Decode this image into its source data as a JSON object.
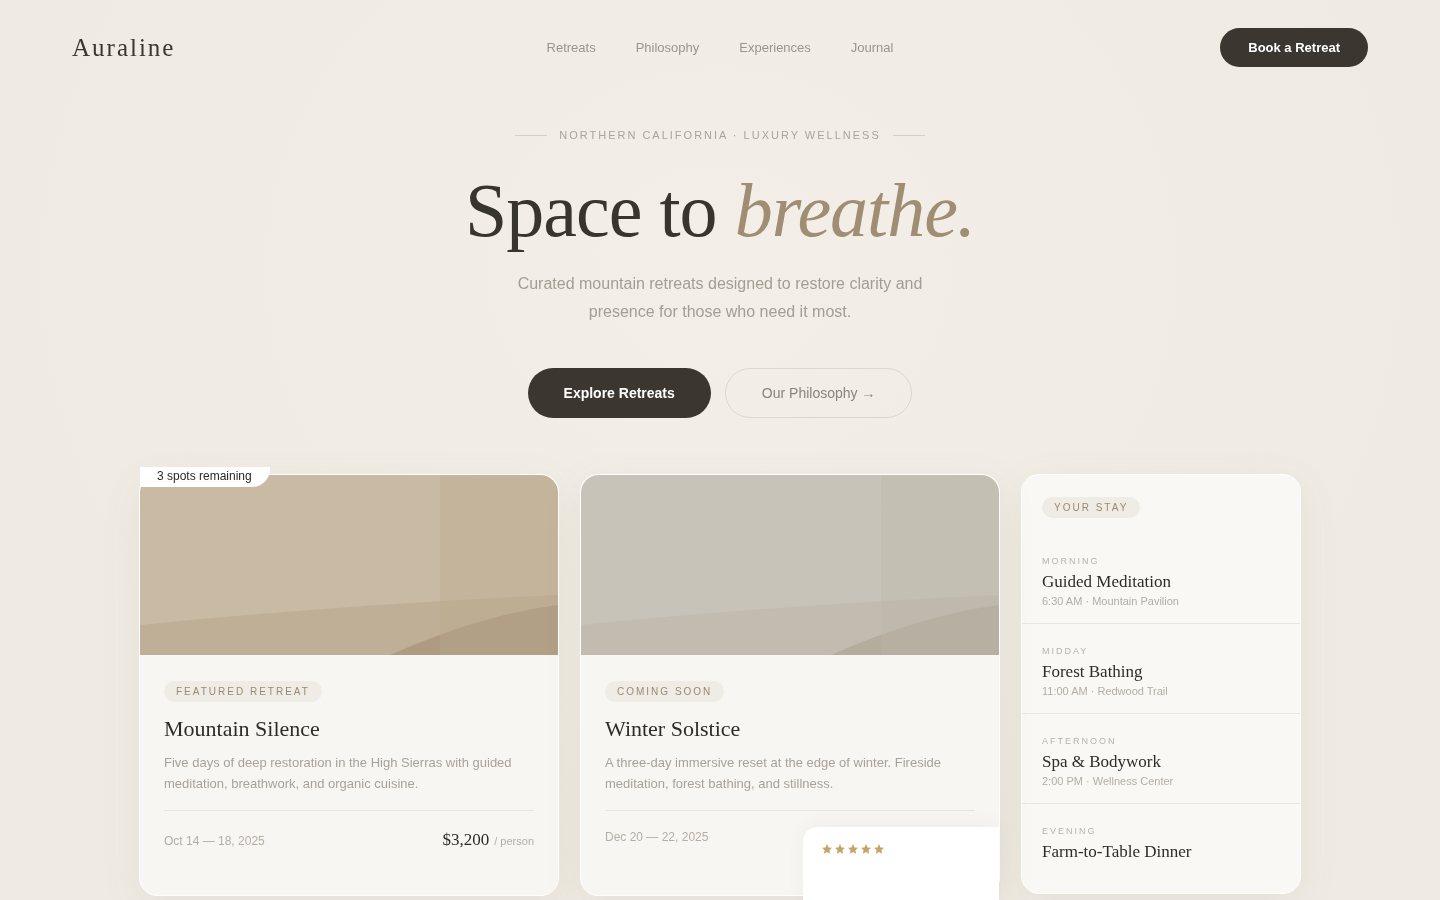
{
  "brand": "Auraline",
  "nav": [
    {
      "label": "Retreats"
    },
    {
      "label": "Philosophy"
    },
    {
      "label": "Experiences"
    },
    {
      "label": "Journal"
    }
  ],
  "cta": "Book a Retreat",
  "hero": {
    "eyebrow": "NORTHERN CALIFORNIA · LUXURY WELLNESS",
    "title": "Space to *breathe.*",
    "subtitle": "Curated mountain retreats designed to restore clarity and presence for those who need it most.",
    "primary_button": "Explore Retreats",
    "secondary_button": "Our Philosophy →"
  },
  "retreats": [
    {
      "badge": "3 spots remaining",
      "tag": "FEATURED RETREAT",
      "title": "Mountain Silence",
      "description": "Five days of deep restoration in the High Sierras with guided meditation, breathwork, and organic cuisine.",
      "dates": "Oct 14 — 18, 2025",
      "price": "$3,200",
      "price_unit": "/ person"
    },
    {
      "tag": "COMING SOON",
      "title": "Winter Solstice",
      "description": "A three-day immersive reset at the edge of winter. Fireside meditation, forest bathing, and stillness.",
      "dates": "Dec 20 — 22, 2025",
      "review": {
        "stars": 5
      }
    }
  ],
  "schedule": {
    "tag": "YOUR STAY",
    "items": [
      {
        "period": "MORNING",
        "title": "Guided Meditation",
        "detail": "6:30 AM · Mountain Pavilion"
      },
      {
        "period": "MIDDAY",
        "title": "Forest Bathing",
        "detail": "11:00 AM · Redwood Trail"
      },
      {
        "period": "AFTERNOON",
        "title": "Spa & Bodywork",
        "detail": "2:00 PM · Wellness Center"
      },
      {
        "period": "EVENING",
        "title": "Farm-to-Table Dinner"
      }
    ]
  }
}
